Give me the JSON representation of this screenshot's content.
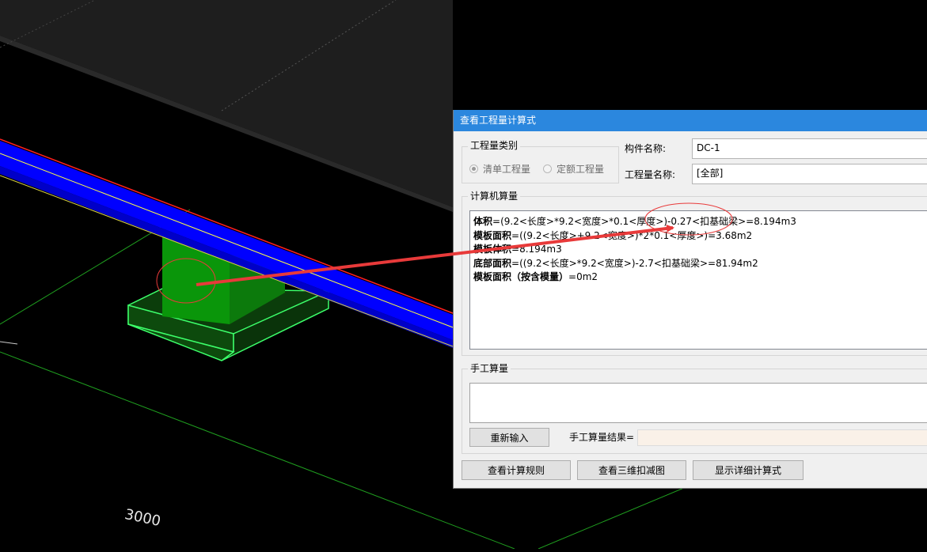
{
  "viewport": {
    "dimension_label": "3000"
  },
  "dialog": {
    "title": "查看工程量计算式",
    "quantity_type": {
      "group_title": "工程量类别",
      "options": [
        "清单工程量",
        "定额工程量"
      ],
      "selected": "清单工程量"
    },
    "component_name_label": "构件名称:",
    "component_name_value": "DC-1",
    "quantity_name_label": "工程量名称:",
    "quantity_name_value": "[全部]",
    "computer_calc": {
      "group_title": "计算机算量",
      "lines": [
        {
          "label": "体积",
          "expr": "=(9.2<长度>*9.2<宽度>*0.1<厚度>)-0.27<扣基础梁>=8.194m3"
        },
        {
          "label": "模板面积",
          "expr": "=((9.2<长度>+9.2<宽度>)*2*0.1<厚度>)=3.68m2"
        },
        {
          "label": "模板体积",
          "expr": "=8.194m3"
        },
        {
          "label": "底部面积",
          "expr": "=((9.2<长度>*9.2<宽度>)-2.7<扣基础梁>=81.94m2"
        },
        {
          "label": "模板面积（按含模量）",
          "expr": "=0m2"
        }
      ]
    },
    "manual_calc": {
      "group_title": "手工算量",
      "reenter_button": "重新输入",
      "result_label": "手工算量结果="
    },
    "buttons": {
      "view_rules": "查看计算规则",
      "view_3d": "查看三维扣减图",
      "show_detail": "显示详细计算式"
    }
  },
  "colors": {
    "titlebar": "#2b87de",
    "beam_blue": "#0000ff",
    "column_green": "#0a960a",
    "annotation_red": "#e83a3a",
    "grid_green": "#1f9f1f"
  }
}
